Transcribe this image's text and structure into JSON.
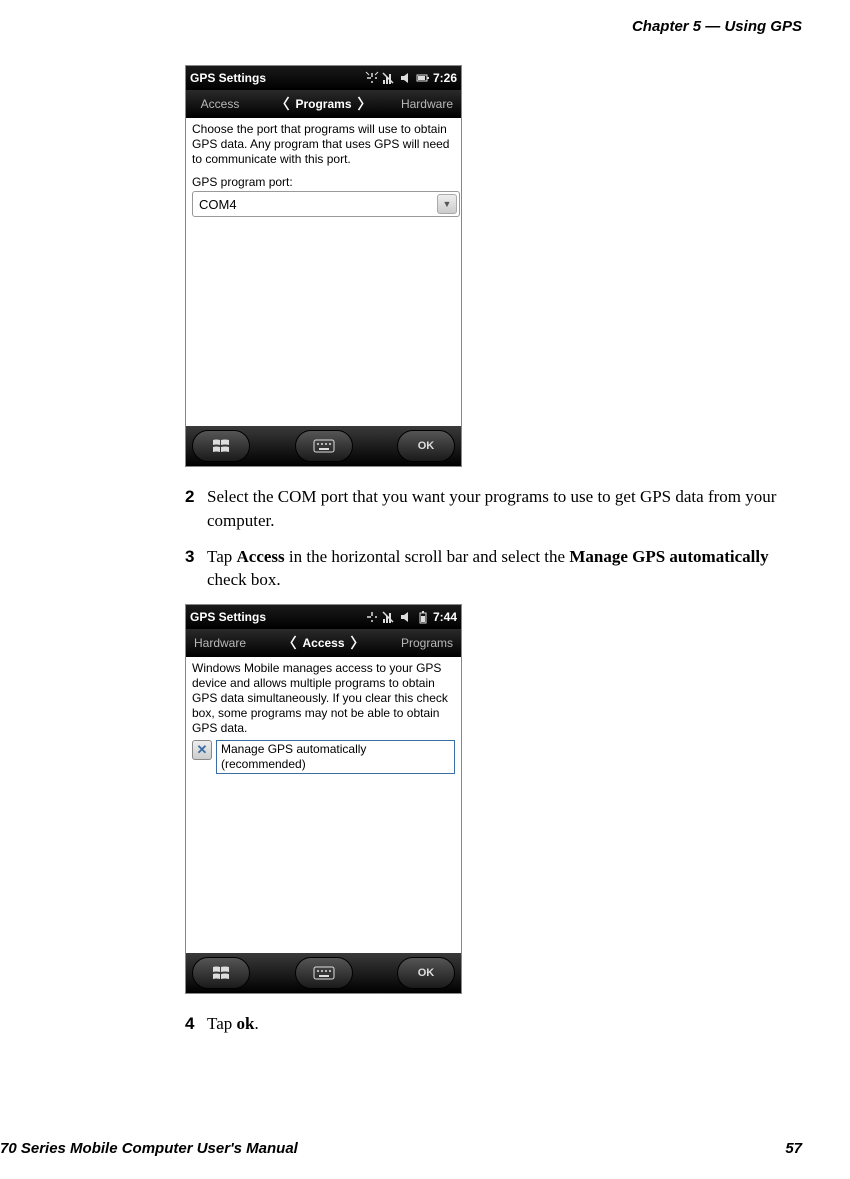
{
  "header": {
    "chapter": "Chapter 5 — Using GPS"
  },
  "screenshot1": {
    "title": "GPS Settings",
    "time": "7:26",
    "tab_left": "Access",
    "tab_center": "Programs",
    "tab_right": "Hardware",
    "helptext": "Choose the port that programs will use to obtain GPS data. Any program that uses GPS will need to communicate with this port.",
    "field_label": "GPS program port:",
    "dropdown_value": "COM4",
    "ok": "OK"
  },
  "step2": {
    "num": "2",
    "text": "Select the COM port that you want your programs to use to get GPS data from your computer."
  },
  "step3": {
    "num": "3",
    "pre": "Tap ",
    "b1": "Access",
    "mid": " in the horizontal scroll bar and select the ",
    "b2": "Manage GPS automatically",
    "post": " check box."
  },
  "screenshot2": {
    "title": "GPS Settings",
    "time": "7:44",
    "tab_left": "Hardware",
    "tab_center": "Access",
    "tab_right": "Programs",
    "helptext": "Windows Mobile manages access to your GPS device and allows multiple programs to obtain GPS data simultaneously. If you clear this check box, some programs may not be able to obtain GPS data.",
    "checkbox_label": "Manage GPS automatically (recommended)",
    "ok": "OK"
  },
  "step4": {
    "num": "4",
    "pre": "Tap ",
    "b1": "ok",
    "post": "."
  },
  "footer": {
    "manual": "70 Series Mobile Computer User's Manual",
    "page": "57"
  }
}
